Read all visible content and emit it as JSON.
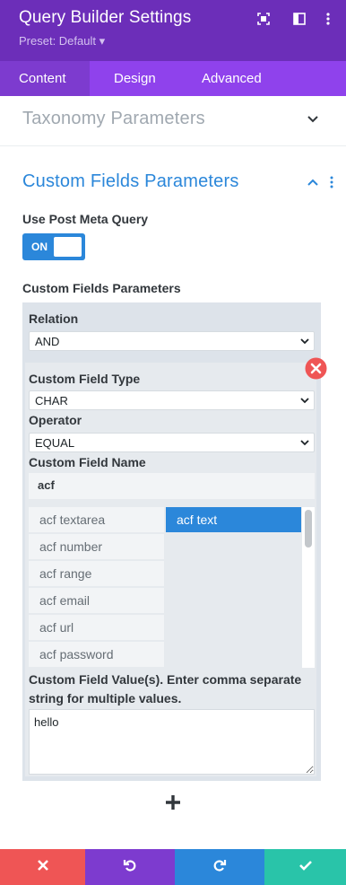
{
  "header": {
    "title": "Query Builder Settings",
    "preset": "Preset: Default ▾",
    "icons": [
      "fullscreen-icon",
      "sidebar-icon",
      "more-icon"
    ],
    "background": "#6c2eb9"
  },
  "tabs": [
    {
      "label": "Content",
      "active": true
    },
    {
      "label": "Design",
      "active": false
    },
    {
      "label": "Advanced",
      "active": false
    }
  ],
  "sections": {
    "taxonomy": {
      "title": "Taxonomy Parameters",
      "expanded": false
    },
    "custom_fields": {
      "title": "Custom Fields Parameters",
      "expanded": true
    }
  },
  "form": {
    "use_meta_label": "Use Post Meta Query",
    "toggle_state": "ON",
    "cf_params_label": "Custom Fields Parameters",
    "relation_label": "Relation",
    "relation_value": "AND",
    "type_label": "Custom Field Type",
    "type_value": "CHAR",
    "operator_label": "Operator",
    "operator_value": "EQUAL",
    "name_label": "Custom Field Name",
    "name_value": "acf",
    "fields_available": [
      "acf textarea",
      "acf number",
      "acf range",
      "acf email",
      "acf url",
      "acf password"
    ],
    "fields_selected": [
      "acf text"
    ],
    "value_label_line1": "Custom Field Value(s). Enter comma separate",
    "value_label_line2": "string for multiple values.",
    "value_text": "hello"
  },
  "colors": {
    "accent": "#2b87da",
    "tab_bar": "#8f42ec",
    "cancel": "#ef5555",
    "undo": "#7d3bcf",
    "redo": "#2b87da",
    "save": "#29c4a9",
    "remove": "#ef5555"
  },
  "bottom_bar": [
    "close-icon",
    "undo-icon",
    "redo-icon",
    "check-icon"
  ]
}
